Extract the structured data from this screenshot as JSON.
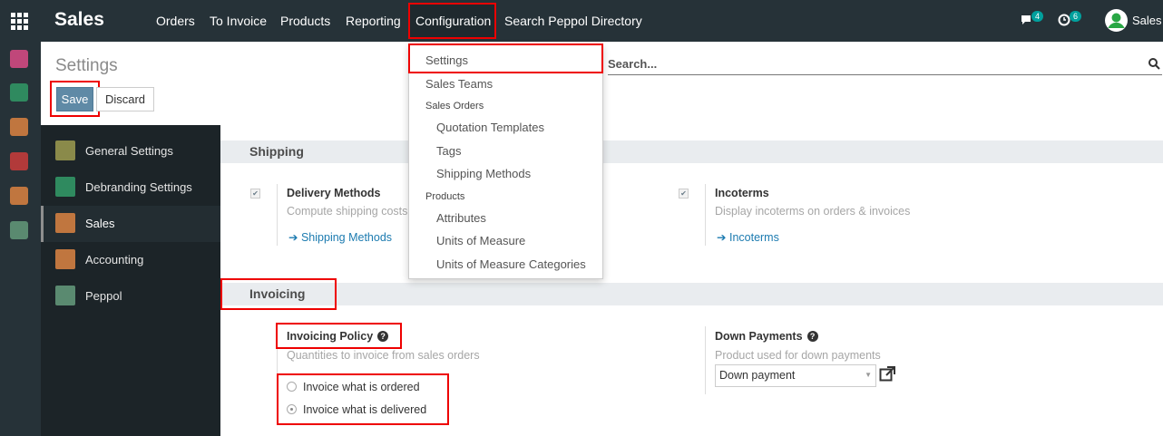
{
  "topbar": {
    "brand": "Sales",
    "menu": [
      "Orders",
      "To Invoice",
      "Products",
      "Reporting",
      "Configuration",
      "Search Peppol Directory"
    ],
    "messages_count": "4",
    "activities_count": "6",
    "user_label": "Sales"
  },
  "control_panel": {
    "title": "Settings",
    "search_placeholder": "Search...",
    "save_label": "Save",
    "discard_label": "Discard"
  },
  "sidebar": {
    "items": [
      {
        "label": "General Settings",
        "icon": "gear-icon",
        "color": "#8a8a4a"
      },
      {
        "label": "Debranding Settings",
        "icon": "brush-icon",
        "color": "#2f8a5f"
      },
      {
        "label": "Sales",
        "icon": "chart-icon",
        "color": "#c0763f"
      },
      {
        "label": "Accounting",
        "icon": "invoice-icon",
        "color": "#c0763f"
      },
      {
        "label": "Peppol",
        "icon": "document-icon",
        "color": "#5a8a70"
      }
    ]
  },
  "dropdown": {
    "settings": "Settings",
    "sales_teams": "Sales Teams",
    "sales_orders_header": "Sales Orders",
    "quotation_templates": "Quotation Templates",
    "tags": "Tags",
    "shipping_methods": "Shipping Methods",
    "products_header": "Products",
    "attributes": "Attributes",
    "units_of_measure": "Units of Measure",
    "uom_categories": "Units of Measure Categories"
  },
  "shipping": {
    "header": "Shipping",
    "delivery_methods": {
      "title": "Delivery Methods",
      "desc": "Compute shipping costs",
      "link": "Shipping Methods",
      "checked": true
    },
    "incoterms": {
      "title": "Incoterms",
      "desc": "Display incoterms on orders & invoices",
      "link": "Incoterms",
      "checked": true
    }
  },
  "invoicing": {
    "header": "Invoicing",
    "policy": {
      "title": "Invoicing Policy",
      "desc": "Quantities to invoice from sales orders",
      "options": [
        "Invoice what is ordered",
        "Invoice what is delivered"
      ],
      "selected": "Invoice what is delivered"
    },
    "down_payments": {
      "title": "Down Payments",
      "desc": "Product used for down payments",
      "value": "Down payment"
    }
  },
  "colors": {
    "topbar": "#263238",
    "accent": "#00a09d",
    "highlight": "#e00000"
  }
}
